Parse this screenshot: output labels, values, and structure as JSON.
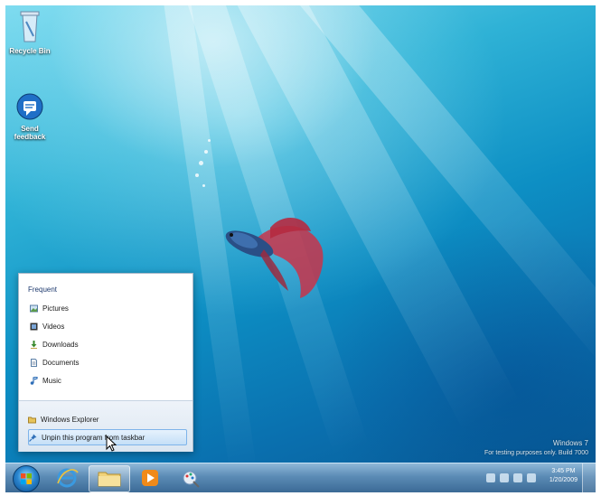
{
  "desktop": {
    "icons": [
      {
        "label": "Recycle Bin"
      },
      {
        "label": "Send\nfeedback"
      }
    ],
    "watermark": {
      "line1": "Windows 7",
      "line2": "For testing purposes only. Build 7000"
    }
  },
  "jumplist": {
    "heading": "Frequent",
    "frequent": [
      {
        "label": "Pictures",
        "icon": "pictures-icon"
      },
      {
        "label": "Videos",
        "icon": "videos-icon"
      },
      {
        "label": "Downloads",
        "icon": "downloads-icon"
      },
      {
        "label": "Documents",
        "icon": "documents-icon"
      },
      {
        "label": "Music",
        "icon": "music-icon"
      }
    ],
    "tasks": [
      {
        "label": "Windows Explorer",
        "icon": "folder-icon"
      },
      {
        "label": "Unpin this program from taskbar",
        "icon": "unpin-icon"
      }
    ]
  },
  "taskbar": {
    "buttons": [
      "start-orb",
      "internet-explorer",
      "windows-explorer",
      "media-player",
      "paint"
    ],
    "clock": {
      "time": "3:45 PM",
      "date": "1/20/2009"
    }
  },
  "colors": {
    "accent": "#0d8fc4",
    "taskbar": "#5b8bb5"
  }
}
